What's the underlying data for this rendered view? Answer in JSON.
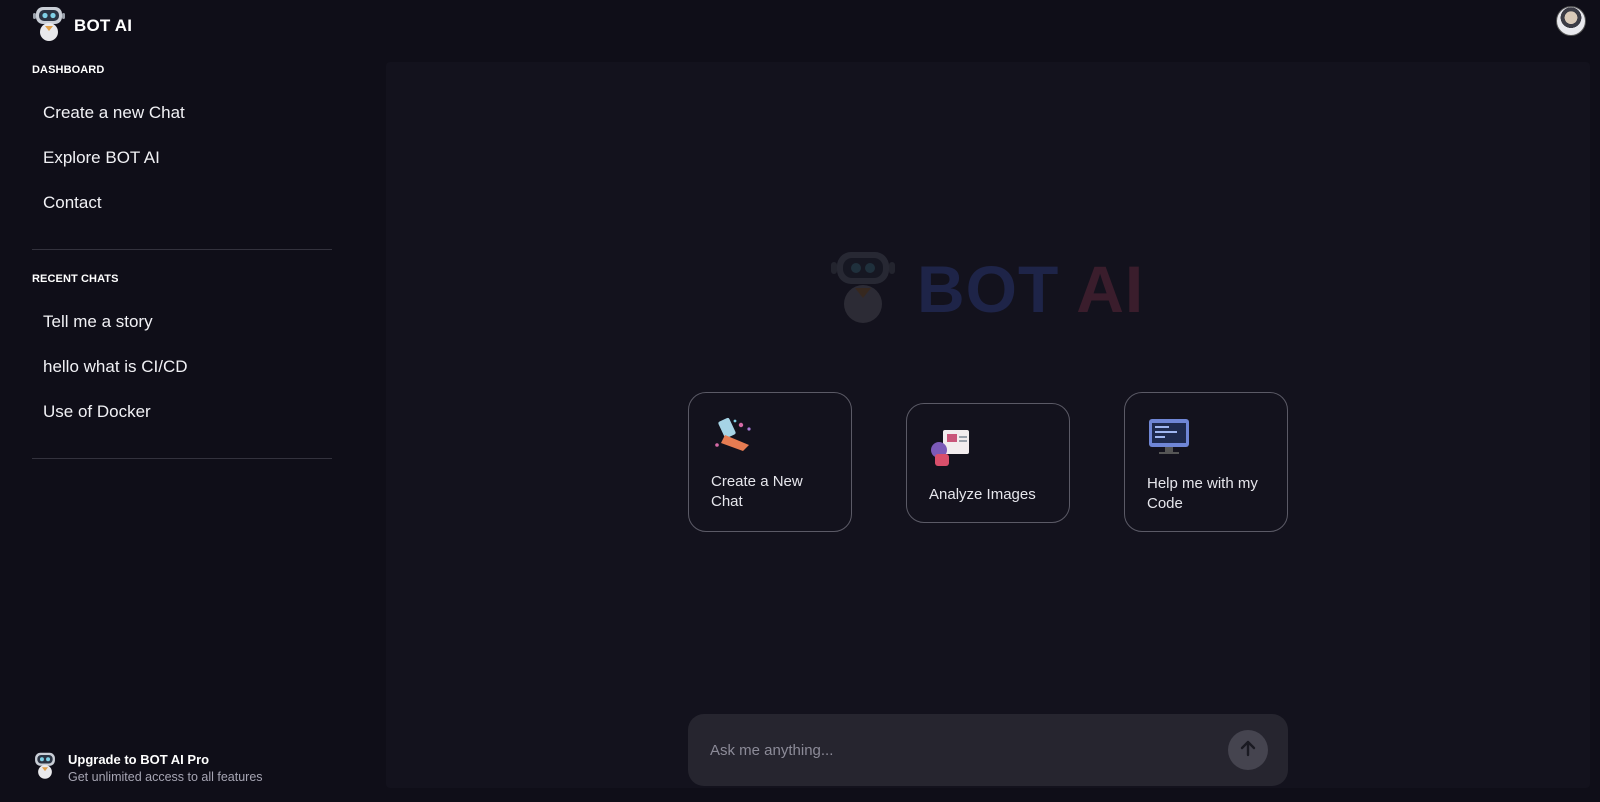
{
  "brand": {
    "name": "BOT AI",
    "logo_icon": "robot-icon"
  },
  "header": {
    "avatar_icon": "user-avatar"
  },
  "sidebar": {
    "dashboard_label": "DASHBOARD",
    "dashboard_items": [
      {
        "label": "Create a new Chat"
      },
      {
        "label": "Explore BOT AI"
      },
      {
        "label": "Contact"
      }
    ],
    "recent_label": "RECENT CHATS",
    "recent_items": [
      {
        "label": "Tell me a story"
      },
      {
        "label": "hello what is CI/CD"
      },
      {
        "label": "Use of Docker"
      }
    ],
    "upgrade": {
      "title": "Upgrade to BOT AI Pro",
      "subtitle": "Get unlimited access to all features"
    }
  },
  "main": {
    "hero": {
      "title_part1": "BOT",
      "title_part2": "AI"
    },
    "cards": [
      {
        "label": "Create a New Chat",
        "icon": "rocket-icon"
      },
      {
        "label": "Analyze Images",
        "icon": "image-analysis-icon"
      },
      {
        "label": "Help me with my Code",
        "icon": "code-monitor-icon"
      }
    ],
    "composer": {
      "placeholder": "Ask me anything...",
      "send_icon": "arrow-up-icon"
    }
  },
  "colors": {
    "background": "#0f0e18",
    "panel": "#13121d",
    "hero_blue": "#1e2448",
    "hero_red": "#3a1d2c",
    "composer": "#26252f"
  }
}
